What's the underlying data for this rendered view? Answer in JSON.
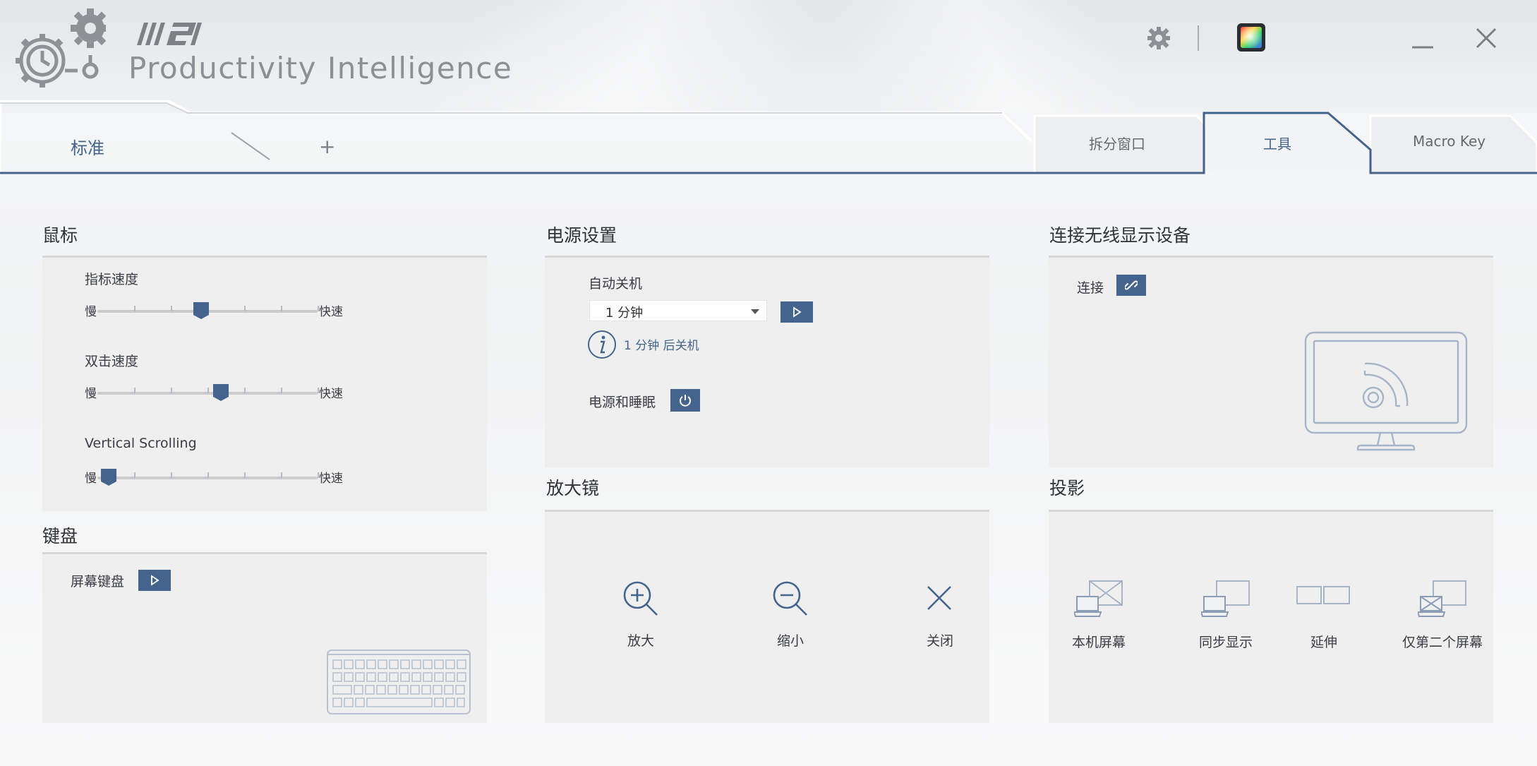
{
  "app": {
    "brand": "MSI",
    "title": "Productivity Intelligence"
  },
  "header": {
    "icons": [
      "gear-icon",
      "color-palette-icon",
      "minimize-icon",
      "close-icon"
    ]
  },
  "tabs": {
    "left": {
      "standard": "标准",
      "add": "+"
    },
    "right": [
      {
        "label": "拆分窗口",
        "active": false
      },
      {
        "label": "工具",
        "active": true
      },
      {
        "label": "Macro Key",
        "active": false
      }
    ]
  },
  "mouse": {
    "title": "鼠标",
    "pointer_speed": {
      "label": "指标速度",
      "min": "慢",
      "max": "快速",
      "value": 0.47
    },
    "double_click": {
      "label": "双击速度",
      "min": "慢",
      "max": "快速",
      "value": 0.56
    },
    "vertical_scrolling": {
      "label": "Vertical Scrolling",
      "min": "慢",
      "max": "快速",
      "value": 0.05
    }
  },
  "keyboard": {
    "title": "键盘",
    "onscreen_keyboard": "屏幕键盘"
  },
  "power": {
    "title": "电源设置",
    "auto_shutdown": "自动关机",
    "selected": "1 分钟",
    "info": "1 分钟 后关机",
    "power_sleep": "电源和睡眠"
  },
  "magnifier": {
    "title": "放大镜",
    "zoom_in": "放大",
    "zoom_out": "缩小",
    "close": "关闭"
  },
  "wireless": {
    "title": "连接无线显示设备",
    "connect": "连接"
  },
  "projection": {
    "title": "投影",
    "pc_only": "本机屏幕",
    "duplicate": "同步显示",
    "extend": "延伸",
    "second_only": "仅第二个屏幕"
  },
  "colors": {
    "accent": "#44648e",
    "panel": "#efefef",
    "icon_line": "#a7b4c8"
  }
}
